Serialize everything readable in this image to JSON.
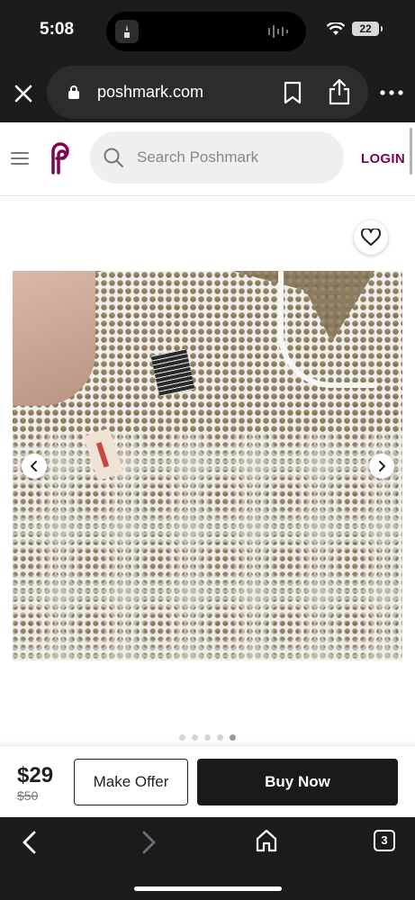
{
  "status_bar": {
    "time": "5:08",
    "battery": "22"
  },
  "browser": {
    "url": "poshmark.com"
  },
  "header": {
    "search_placeholder": "Search Poshmark",
    "login_label": "LOGIN"
  },
  "listing": {
    "carousel": {
      "total_images": 5,
      "active_index": 4
    }
  },
  "purchase": {
    "price": "$29",
    "original_price": "$50",
    "make_offer_label": "Make Offer",
    "buy_now_label": "Buy Now"
  },
  "toolbar": {
    "tab_count": "3"
  },
  "colors": {
    "brand": "#7f0353",
    "dark_chrome": "#1c1c1e",
    "buy_button": "#1a1a1a"
  }
}
